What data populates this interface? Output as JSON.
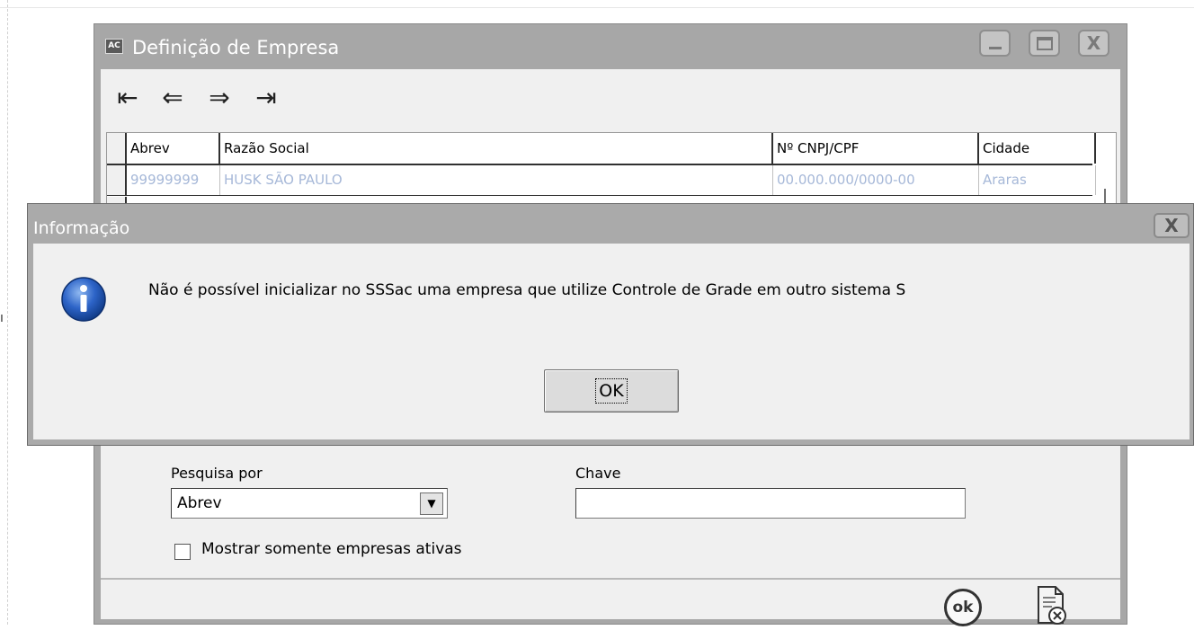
{
  "main_window": {
    "icon_text": "AC",
    "title": "Definição de Empresa",
    "nav": {
      "first": "⇤",
      "prev": "⇐",
      "next": "⇒",
      "last": "⇥"
    },
    "grid": {
      "columns": [
        "Abrev",
        "Razão Social",
        "Nº CNPJ/CPF",
        "Cidade"
      ],
      "rows": [
        [
          "99999999",
          "HUSK SÃO PAULO",
          "00.000.000/0000-00",
          "Araras"
        ]
      ]
    },
    "search": {
      "search_by_label": "Pesquisa por",
      "search_by_value": "Abrev",
      "key_label": "Chave",
      "key_value": "",
      "active_only_label": "Mostrar somente empresas ativas",
      "active_only_checked": false
    },
    "footer": {
      "ok_icon_text": "ok"
    }
  },
  "dialog": {
    "title": "Informação",
    "message": "Não é possível inicializar no SSSac uma empresa que utilize Controle de Grade em outro sistema S",
    "ok_label": "OK",
    "close_glyph": "X"
  },
  "icons": {
    "info": "info-icon",
    "nav_first": "first-record-icon",
    "nav_prev": "previous-record-icon",
    "nav_next": "next-record-icon",
    "nav_last": "last-record-icon",
    "confirm": "ok-icon",
    "cancel": "cancel-document-icon"
  }
}
